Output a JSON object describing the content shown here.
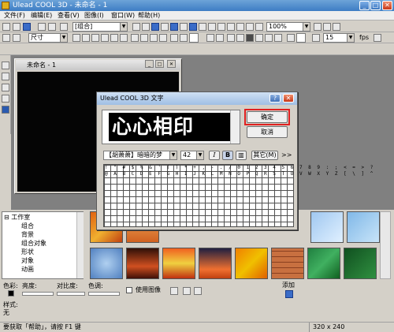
{
  "app": {
    "title": "Ulead COOL 3D - 未命名 - 1"
  },
  "menu": [
    "文件(F)",
    "编辑(E)",
    "查看(V)",
    "图像(I)",
    "窗口(W)",
    "帮助(H)"
  ],
  "toolbar1": {
    "object_combo": "[组合]",
    "zoom_combo": "100%",
    "spin_value": "15",
    "fps_label": "fps"
  },
  "toolbar2": {
    "size_combo": "尺寸"
  },
  "doc_window": {
    "title": "未命名 - 1"
  },
  "dialog": {
    "title": "Ulead COOL 3D 文字",
    "preview_text": "心心相印",
    "ok": "确定",
    "cancel": "取消",
    "font_combo": "【胡萧萧】暗暗的梦",
    "size_combo": "42",
    "italic": "I",
    "bold": "B",
    "other": "其它(M)",
    "more": ">>",
    "char_row": "! \" # $ % & ' ( ) * + , - . / 0 1 2 3 4 5 6 7 8 9 : ; < = > ?",
    "char_row2": "@ A B C D E F G H I J K L M N O P Q R S T U V W X Y Z [ \\ ] ^"
  },
  "tree": {
    "root": "工作室",
    "items": [
      "组合",
      "背景",
      "组合对象",
      "形状",
      "对象",
      "动画"
    ]
  },
  "controls": {
    "color_label": "色彩:",
    "brightness_label": "亮度:",
    "contrast_label": "对比度:",
    "hue_label": "色调:",
    "use_image_label": "使用图像",
    "add_label": "添加",
    "style_label": "样式:",
    "style_value": "无"
  },
  "status": {
    "left": "要获取「帮助」，请按 F1 键",
    "right": "320 x 240"
  },
  "colors": {
    "accent_red": "#e02020",
    "title_blue": "#3d7dc4"
  }
}
